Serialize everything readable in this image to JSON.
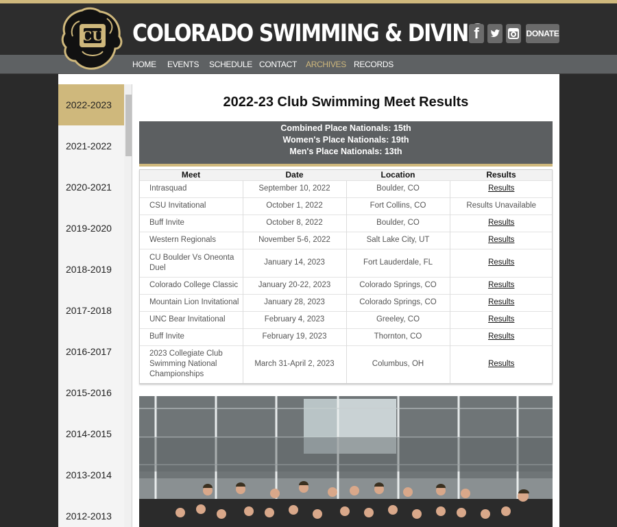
{
  "site": {
    "title": "COLORADO SWIMMING & DIVING",
    "logo_text": "CU",
    "donate_label": "DONATE",
    "social": {
      "facebook": "f",
      "twitter": "t",
      "instagram": "ig"
    }
  },
  "nav": [
    {
      "label": "HOME"
    },
    {
      "label": "EVENTS"
    },
    {
      "label": "SCHEDULE"
    },
    {
      "label": "CONTACT"
    },
    {
      "label": "ARCHIVES",
      "active": true
    },
    {
      "label": "RECORDS"
    }
  ],
  "sidebar": {
    "years": [
      "2022-2023",
      "2021-2022",
      "2020-2021",
      "2019-2020",
      "2018-2019",
      "2017-2018",
      "2016-2017",
      "2015-2016",
      "2014-2015",
      "2013-2014",
      "2012-2013"
    ],
    "active": "2022-2023"
  },
  "main": {
    "title": "2022-23 Club Swimming Meet Results",
    "summary": [
      "Combined Place Nationals: 15th",
      "Women's Place Nationals: 19th",
      "Men's Place Nationals: 13th"
    ],
    "table": {
      "headers": [
        "Meet",
        "Date",
        "Location",
        "Results"
      ],
      "rows": [
        {
          "meet": "Intrasquad",
          "date": "September 10, 2022",
          "location": "Boulder, CO",
          "result": "Results",
          "link": true
        },
        {
          "meet": "CSU Invitational",
          "date": "October 1, 2022",
          "location": "Fort Collins, CO",
          "result": "Results Unavailable",
          "link": false
        },
        {
          "meet": "Buff Invite",
          "date": "October 8, 2022",
          "location": "Boulder, CO",
          "result": "Results",
          "link": true
        },
        {
          "meet": "Western Regionals",
          "date": "November 5-6, 2022",
          "location": "Salt Lake City, UT",
          "result": "Results",
          "link": true
        },
        {
          "meet": "CU Boulder Vs Oneonta Duel",
          "date": "January 14, 2023",
          "location": "Fort Lauderdale, FL",
          "result": "Results",
          "link": true
        },
        {
          "meet": "Colorado College Classic",
          "date": "January 20-22, 2023",
          "location": "Colorado Springs, CO",
          "result": "Results",
          "link": true
        },
        {
          "meet": "Mountain Lion Invitational",
          "date": "January 28, 2023",
          "location": "Colorado Springs, CO",
          "result": "Results",
          "link": true
        },
        {
          "meet": "UNC Bear Invitational",
          "date": "February 4, 2023",
          "location": "Greeley, CO",
          "result": "Results",
          "link": true
        },
        {
          "meet": "Buff Invite",
          "date": "February 19, 2023",
          "location": "Thornton, CO",
          "result": "Results",
          "link": true
        },
        {
          "meet": "2023 Collegiate Club Swimming National Championships",
          "date": "March 31-April 2, 2023",
          "location": "Columbus, OH",
          "result": "Results",
          "link": true
        }
      ]
    }
  },
  "colors": {
    "gold": "#cfb87c",
    "header_bg": "#2d2d2d",
    "nav_bg": "#5e6163",
    "summary_bg": "#5c5f61"
  }
}
